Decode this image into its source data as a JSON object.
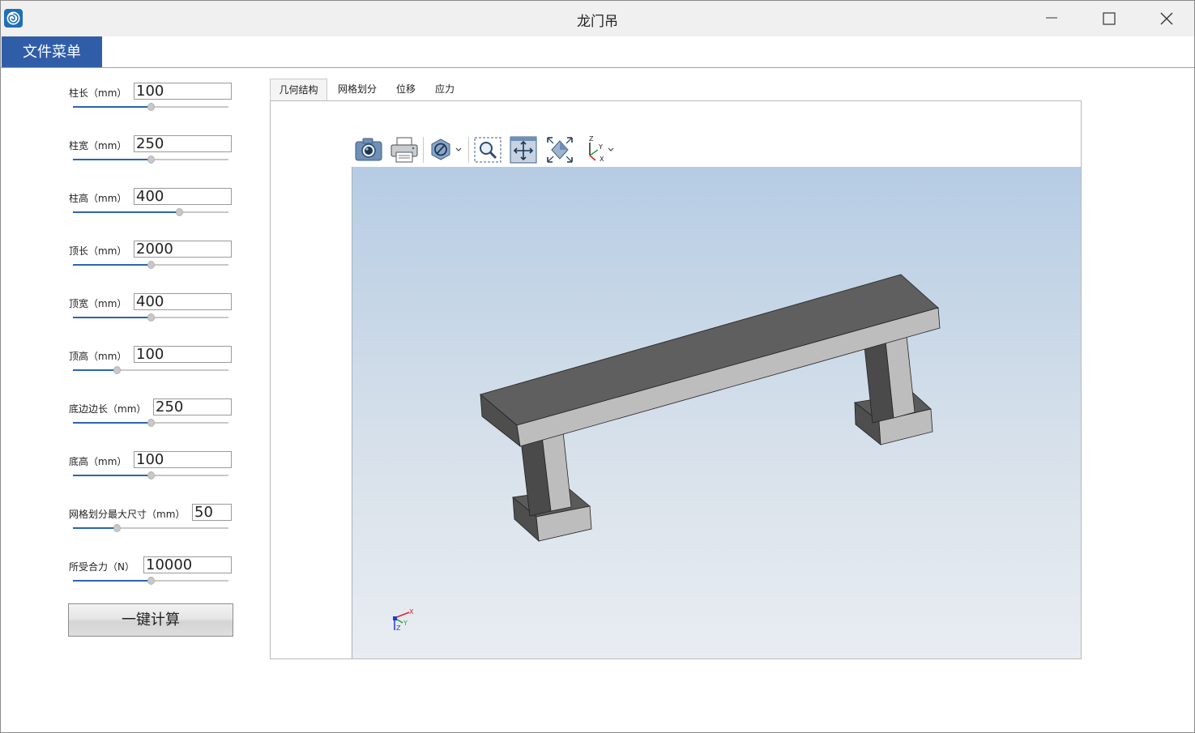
{
  "window": {
    "title": "龙门吊",
    "app_icon": "app-logo-icon",
    "controls": [
      "minimize-icon",
      "maximize-icon",
      "close-icon"
    ]
  },
  "menu": {
    "file_menu": "文件菜单"
  },
  "params": [
    {
      "label": "柱长（mm）",
      "value": "100",
      "slider": 0.5
    },
    {
      "label": "柱宽（mm）",
      "value": "250",
      "slider": 0.5
    },
    {
      "label": "柱高（mm）",
      "value": "400",
      "slider": 0.68
    },
    {
      "label": "顶长（mm）",
      "value": "2000",
      "slider": 0.5
    },
    {
      "label": "顶宽（mm）",
      "value": "400",
      "slider": 0.5
    },
    {
      "label": "顶高（mm）",
      "value": "100",
      "slider": 0.28
    },
    {
      "label": "底边边长（mm）",
      "value": "250",
      "slider": 0.5
    },
    {
      "label": "底高（mm）",
      "value": "100",
      "slider": 0.5
    },
    {
      "label": "网格划分最大尺寸（mm）",
      "value": "50",
      "slider": 0.28
    },
    {
      "label": "所受合力（N）",
      "value": "10000",
      "slider": 0.5
    }
  ],
  "calc_button": "一键计算",
  "tabs": [
    {
      "label": "几何结构",
      "active": true
    },
    {
      "label": "网格划分",
      "active": false
    },
    {
      "label": "位移",
      "active": false
    },
    {
      "label": "应力",
      "active": false
    }
  ],
  "viewer_toolbar": [
    "camera-icon",
    "print-icon",
    "display-mode-icon",
    "zoom-window-icon",
    "pan-icon",
    "fit-all-icon",
    "view-orientation-icon"
  ],
  "axes": {
    "toolbar_axis_labels": [
      "Z",
      "Y",
      "X"
    ],
    "triad_labels": [
      "X",
      "Y",
      "Z"
    ]
  },
  "colors": {
    "accent": "#2f5da8",
    "slider_fill": "#2a65b0",
    "viewport_top": "#b6cce4",
    "viewport_bottom": "#e9edf2",
    "model_dark": "#5f5f5f",
    "model_light": "#bdbdbd"
  }
}
